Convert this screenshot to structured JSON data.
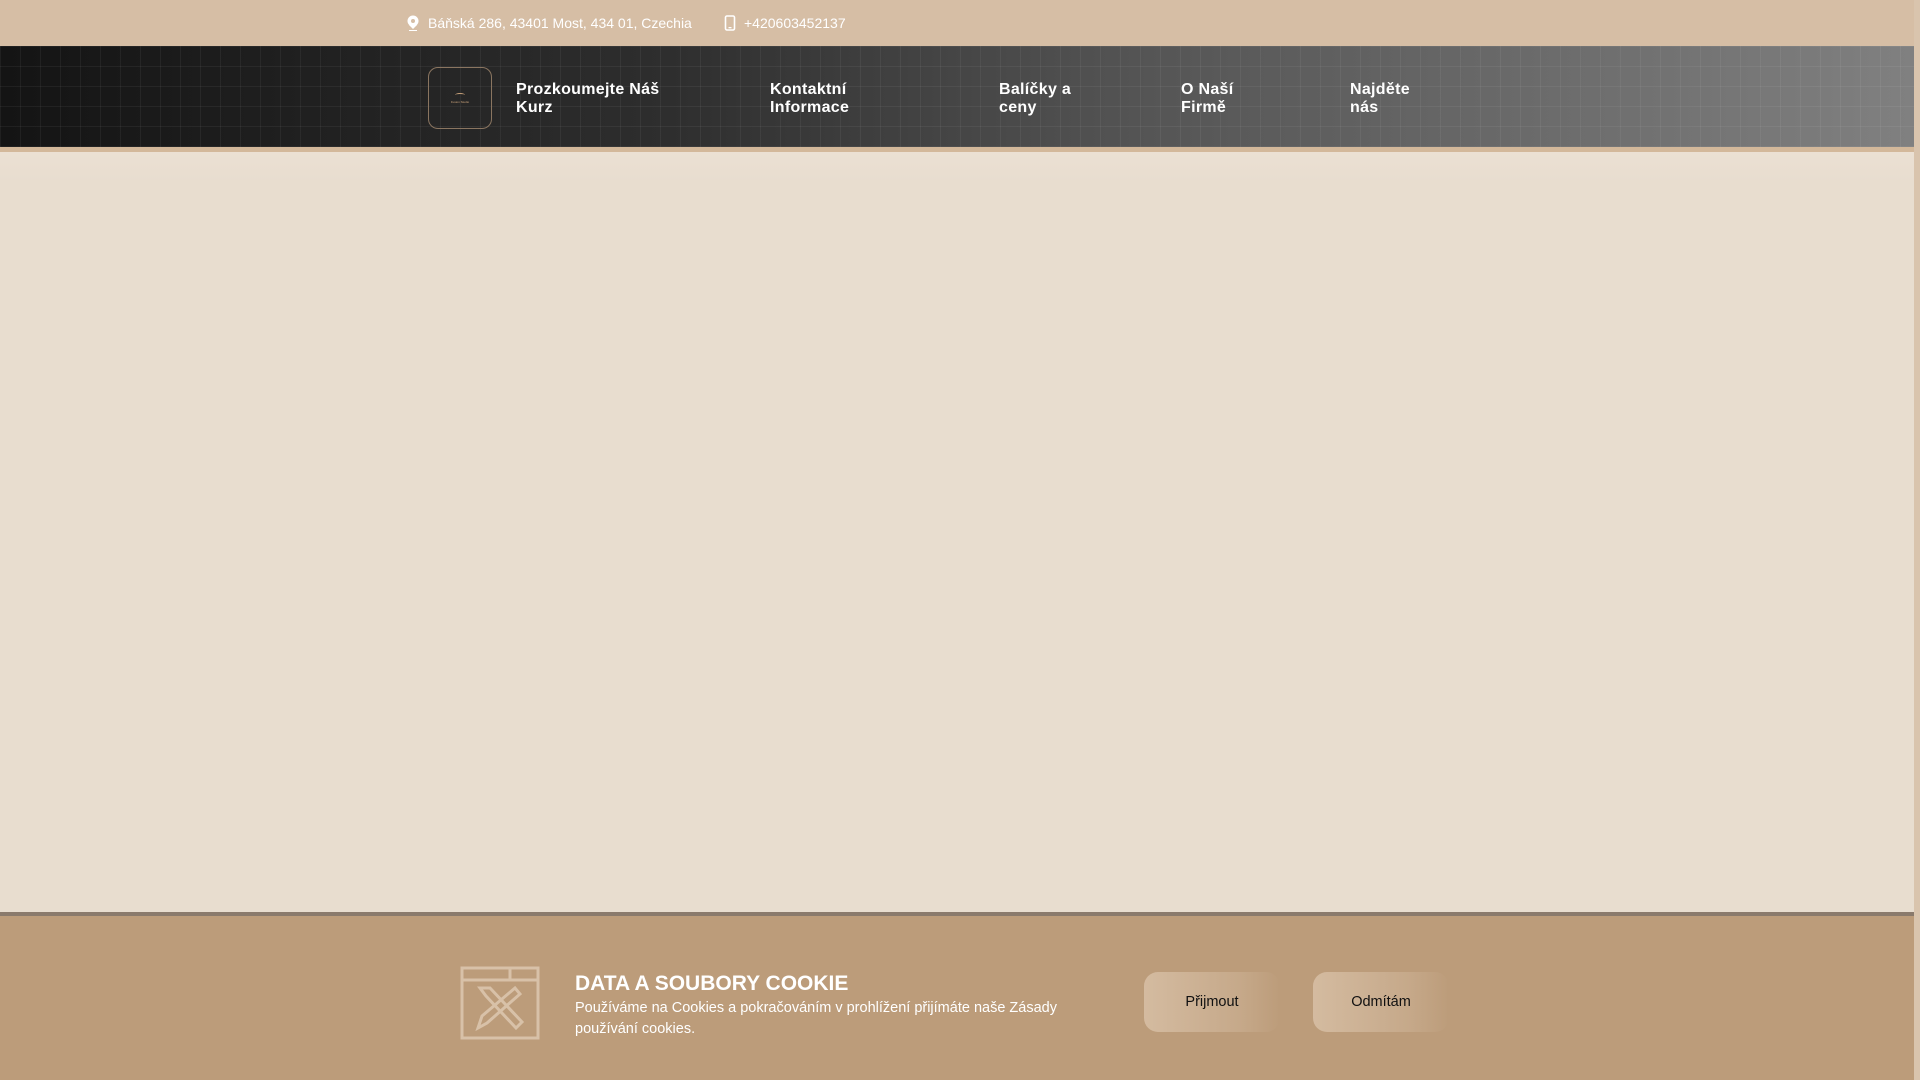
{
  "topbar": {
    "address": "Báňská 286, 43401 Most, 434 01, Czechia",
    "phone": "+420603452137"
  },
  "logo": {
    "text": "Fusion Studio"
  },
  "nav": {
    "items": [
      {
        "line1": "Prozkoumejte Náš",
        "line2": "Kurz"
      },
      {
        "line1": "Kontaktní",
        "line2": "Informace"
      },
      {
        "line1": "Balíčky a",
        "line2": "ceny"
      },
      {
        "line1": "O Naší",
        "line2": "Firmě"
      },
      {
        "line1": "Najděte",
        "line2": "nás"
      }
    ]
  },
  "cookie": {
    "title": "DATA A SOUBORY COOKIE",
    "text": "Používáme na Cookies a pokračováním v prohlížení přijímáte naše Zásady používání cookies.",
    "accept": "Přijmout",
    "decline": "Odmítám"
  },
  "colors": {
    "topbar": "#d6bea5",
    "cookie_bg": "#bc9c7a",
    "page_bg": "#e8ddcf"
  }
}
